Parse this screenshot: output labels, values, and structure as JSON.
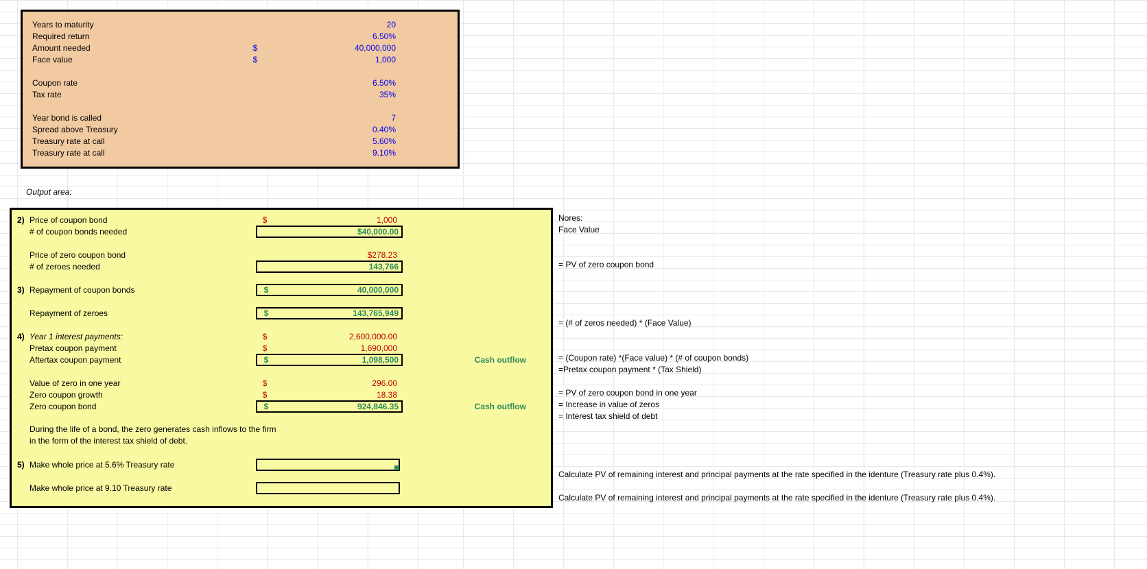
{
  "input": {
    "rows": [
      {
        "label": "Years to maturity",
        "sym": "",
        "value": "20"
      },
      {
        "label": "Required return",
        "sym": "",
        "value": "6.50%"
      },
      {
        "label": "Amount needed",
        "sym": "$",
        "value": "40,000,000"
      },
      {
        "label": "Face value",
        "sym": "$",
        "value": "1,000"
      }
    ],
    "rows2": [
      {
        "label": "Coupon rate",
        "sym": "",
        "value": "6.50%"
      },
      {
        "label": "Tax rate",
        "sym": "",
        "value": "35%"
      }
    ],
    "rows3": [
      {
        "label": "Year bond is called",
        "sym": "",
        "value": "7"
      },
      {
        "label": "Spread above Treasury",
        "sym": "",
        "value": "0.40%"
      },
      {
        "label": "Treasury rate at call",
        "sym": "",
        "value": "5.60%"
      },
      {
        "label": "Treasury rate at call",
        "sym": "",
        "value": "9.10%"
      }
    ]
  },
  "outputLabel": "Output area:",
  "output": {
    "q2": {
      "num": "2)",
      "r1": {
        "label": "Price of coupon bond",
        "sym": "$",
        "value": "1,000"
      },
      "r2": {
        "label": "# of coupon bonds needed",
        "sym": "",
        "value": "$40,000.00"
      },
      "r3": {
        "label": "Price of zero coupon bond",
        "sym": "",
        "value": "$278.23"
      },
      "r4": {
        "label": "# of zeroes needed",
        "sym": "",
        "value": "143,766"
      }
    },
    "q3": {
      "num": "3)",
      "r1": {
        "label": "Repayment of coupon bonds",
        "sym": "$",
        "value": "40,000,000"
      },
      "r2": {
        "label": "Repayment of zeroes",
        "sym": "$",
        "value": "143,765,949"
      }
    },
    "q4": {
      "num": "4)",
      "r1": {
        "label": "Year 1 interest payments:",
        "sym": "$",
        "value": "2,600,000.00"
      },
      "r2": {
        "label": "Pretax coupon payment",
        "sym": "$",
        "value": "1,690,000"
      },
      "r3": {
        "label": "Aftertax coupon payment",
        "sym": "$",
        "value": "1,098,500",
        "note": "Cash outflow"
      },
      "r4": {
        "label": "Value of zero in one year",
        "sym": "$",
        "value": "296.00"
      },
      "r5": {
        "label": "Zero coupon growth",
        "sym": "$",
        "value": "18.38"
      },
      "r6": {
        "label": "Zero coupon bond",
        "sym": "$",
        "value": "924,846.35",
        "note": "Cash outflow"
      },
      "p1": "During the life of a bond, the zero generates cash inflows to the firm",
      "p2": "in the form of the interest tax shield of debt."
    },
    "q5": {
      "num": "5)",
      "r1": {
        "label": "Make whole price at 5.6% Treasury rate"
      },
      "r2": {
        "label": "Make whole price at 9.10 Treasury rate"
      }
    }
  },
  "notes": {
    "header": "Nores:",
    "n1": "Face Value",
    "n2": "= PV of zero coupon bond",
    "n3": "= (# of zeros needed) * (Face Value)",
    "n4": "= (Coupon rate) *(Face value) * (# of coupon bonds)",
    "n5": "=Pretax coupon payment * (Tax Shield)",
    "n6": "= PV of zero coupon bond in one year",
    "n7": "= Increase in value of zeros",
    "n8": "= Interest tax shield of debt",
    "n9": "Calculate PV of remaining interest and principal payments at the rate specified in the identure (Treasury rate plus 0.4%).",
    "n10": "Calculate PV of remaining interest and principal payments at the rate specified in the identure (Treasury rate plus 0.4%)."
  }
}
